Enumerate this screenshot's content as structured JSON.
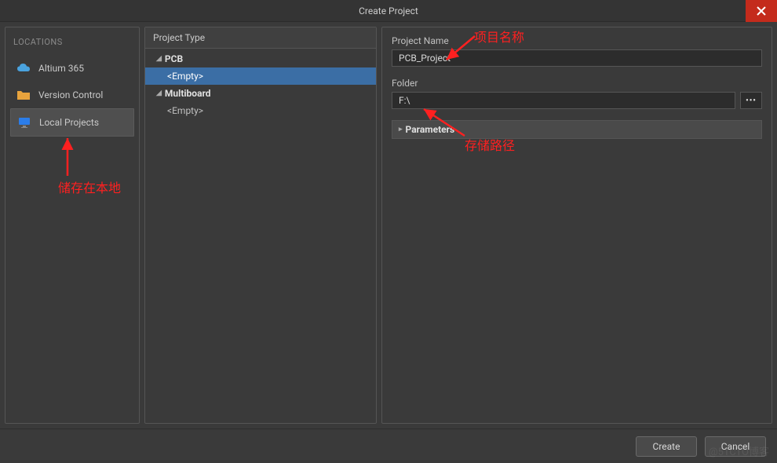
{
  "dialog": {
    "title": "Create Project"
  },
  "sidebar": {
    "header": "LOCATIONS",
    "items": [
      {
        "label": "Altium 365",
        "icon": "cloud"
      },
      {
        "label": "Version Control",
        "icon": "folder"
      },
      {
        "label": "Local Projects",
        "icon": "monitor"
      }
    ],
    "selectedIndex": 2
  },
  "projectTypePanel": {
    "header": "Project Type",
    "groups": [
      {
        "label": "PCB",
        "items": [
          "<Empty>"
        ]
      },
      {
        "label": "Multiboard",
        "items": [
          "<Empty>"
        ]
      }
    ],
    "selected": "PCB.<Empty>"
  },
  "form": {
    "projectNameLabel": "Project Name",
    "projectNameValue": "PCB_Project",
    "folderLabel": "Folder",
    "folderValue": "F:\\",
    "browseIcon": "•••",
    "parametersLabel": "Parameters"
  },
  "buttons": {
    "create": "Create",
    "cancel": "Cancel"
  },
  "annotations": {
    "projectName": "项目名称",
    "folder": "存储路径",
    "local": "储存在本地"
  },
  "watermark": "@51CTO博客"
}
